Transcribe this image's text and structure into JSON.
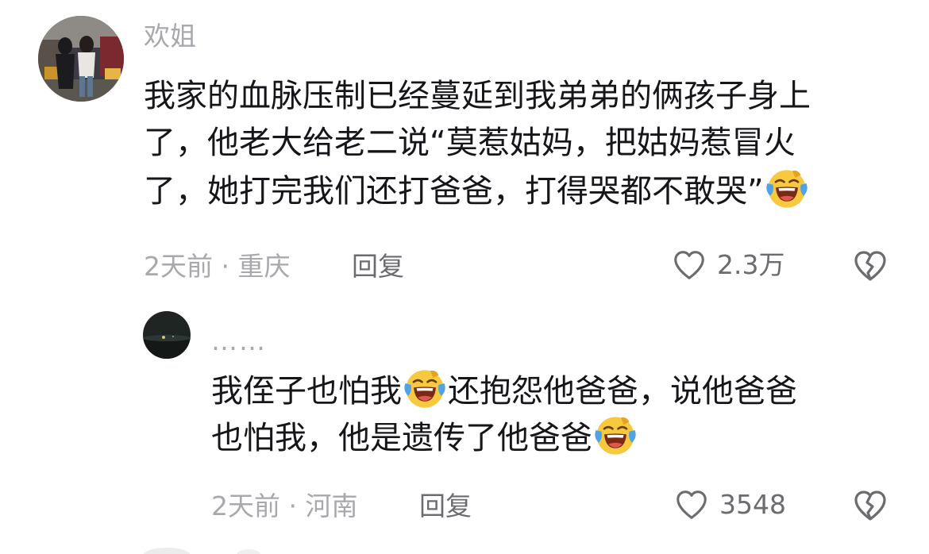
{
  "comment": {
    "username": "欢姐",
    "text_lines": [
      [
        "我家的血脉压制已经蔓延到我弟弟的俩孩子身上"
      ],
      [
        "了，他老大给老二说“莫惹姑妈，把姑妈惹冒火"
      ],
      [
        "了，她打完我们还打爸爸，打得哭都不敢哭”",
        "emoji:laughing-crying"
      ]
    ],
    "time_location": "2天前 · 重庆",
    "reply_label": "回复",
    "likes": "2.3万"
  },
  "reply": {
    "username": "……",
    "text_lines": [
      [
        "我侄子也怕我",
        "emoji:laughing-crying",
        "还抱怨他爸爸，说他爸爸"
      ],
      [
        "也怕我，他是遗传了他爸爸",
        "emoji:laughing-crying"
      ]
    ],
    "time_location": "2天前 · 河南",
    "reply_label": "回复",
    "likes": "3548"
  },
  "icons": {
    "like": "heart-outline-icon",
    "dislike": "broken-heart-icon",
    "emoji": "laughing-crying-emoji"
  },
  "colors": {
    "text_primary": "#16161a",
    "text_secondary": "#a8a8ad",
    "action_text": "#6b6b70",
    "emoji_yellow": "#f7c93e"
  }
}
